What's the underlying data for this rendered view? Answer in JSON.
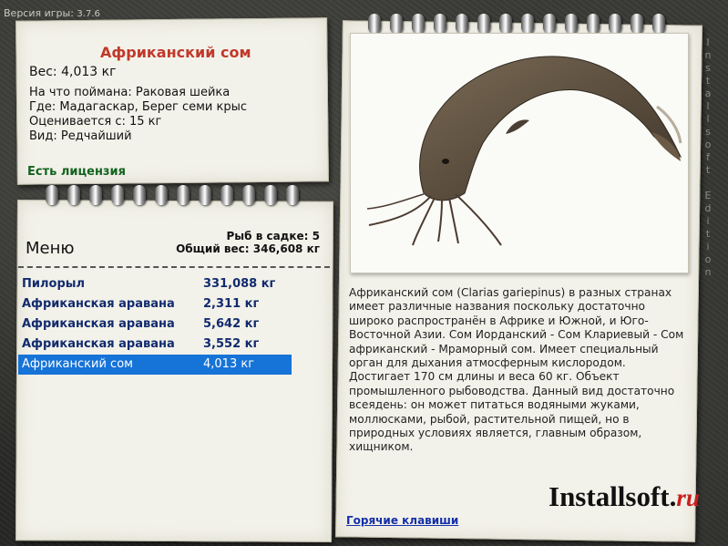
{
  "version": {
    "label": "Версия игры:",
    "number": "3.7.6"
  },
  "fish": {
    "title": "Африканский сом",
    "weight": "Вес: 4,013 кг",
    "bait": "На что поймана: Раковая шейка",
    "location": "Где: Мадагаскар, Берег семи крыс",
    "valued_from": "Оценивается с: 15 кг",
    "kind": "Вид: Редчайший"
  },
  "license": "Есть лицензия",
  "menu": {
    "title": "Меню",
    "fish_count": "Рыб в садке: 5",
    "total_weight": "Общий вес: 346,608 кг",
    "items": [
      {
        "name": "Пилорыл",
        "weight": "331,088 кг"
      },
      {
        "name": "Африканская аравана",
        "weight": "2,311 кг"
      },
      {
        "name": "Африканская аравана",
        "weight": "5,642 кг"
      },
      {
        "name": "Африканская аравана",
        "weight": "3,552 кг"
      },
      {
        "name": "Африканский сом",
        "weight": "4,013 кг"
      }
    ],
    "selected_index": 4
  },
  "description": "Африканский сом (Clarias gariepinus) в разных странах имеет различные названия поскольку достаточно широко распространён в Африке и Южной, и Юго-Восточной Азии. Сом Иорданский - Сом Клариевый - Сом африканский - Мраморный сом. Имеет специальный орган для дыхания атмосферным кислородом. Достигает 170 см длины и веса 60 кг. Объект промышленного рыбоводства. Данный вид достаточно всеядень: он может питаться водяными жуками, моллюсками, рыбой, растительной пищей, но в природных условиях является, главным образом, хищником.",
  "logo": {
    "main": "Installsoft.",
    "tld": "ru"
  },
  "hotkeys": "Горячие клавиши",
  "vertical_text": "Installsoft Edition",
  "colors": {
    "title": "#c0392b",
    "license": "#12631f",
    "list": "#122b6e",
    "selection": "#1673d8",
    "link": "#1530a8"
  }
}
